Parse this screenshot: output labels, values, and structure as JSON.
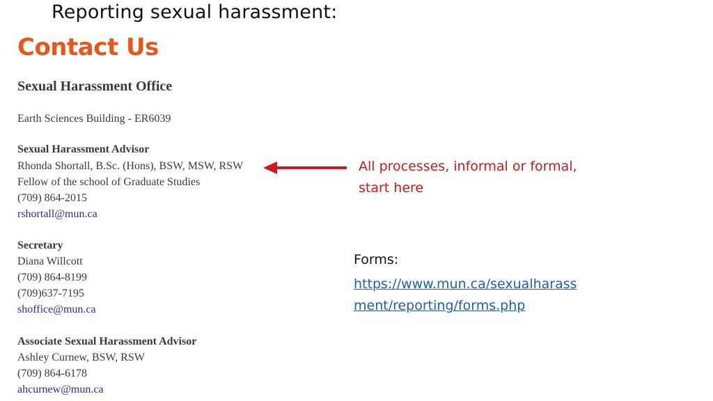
{
  "slide": {
    "title": "Reporting sexual harassment:"
  },
  "contact": {
    "heading": "Contact Us",
    "office": {
      "title": "Sexual Harassment Office",
      "location": "Earth Sciences Building - ER6039"
    },
    "advisor": {
      "title": "Sexual Harassment Advisor",
      "name": "Rhonda Shortall, B.Sc. (Hons), BSW, MSW, RSW",
      "fellowship": "Fellow of the school of Graduate Studies",
      "phone": "(709) 864-2015",
      "email": "rshortall@mun.ca"
    },
    "secretary": {
      "title": "Secretary",
      "name": "Diana Willcott",
      "phone1": "(709) 864-8199",
      "phone2": "(709)637-7195",
      "email": "shoffice@mun.ca"
    },
    "associate": {
      "title": "Associate Sexual Harassment Advisor",
      "name": "Ashley Curnew, BSW, RSW",
      "phone": "(709) 864-6178",
      "email": "ahcurnew@mun.ca"
    }
  },
  "annotation": {
    "text": "All processes, informal or formal, start here",
    "color": "#d0181a"
  },
  "forms": {
    "label": "Forms:",
    "url": "https://www.mun.ca/sexualharassment/reporting/forms.php"
  },
  "colors": {
    "heading": "#e8571a",
    "link": "#1f5fb0",
    "email": "#2d2d8a"
  }
}
